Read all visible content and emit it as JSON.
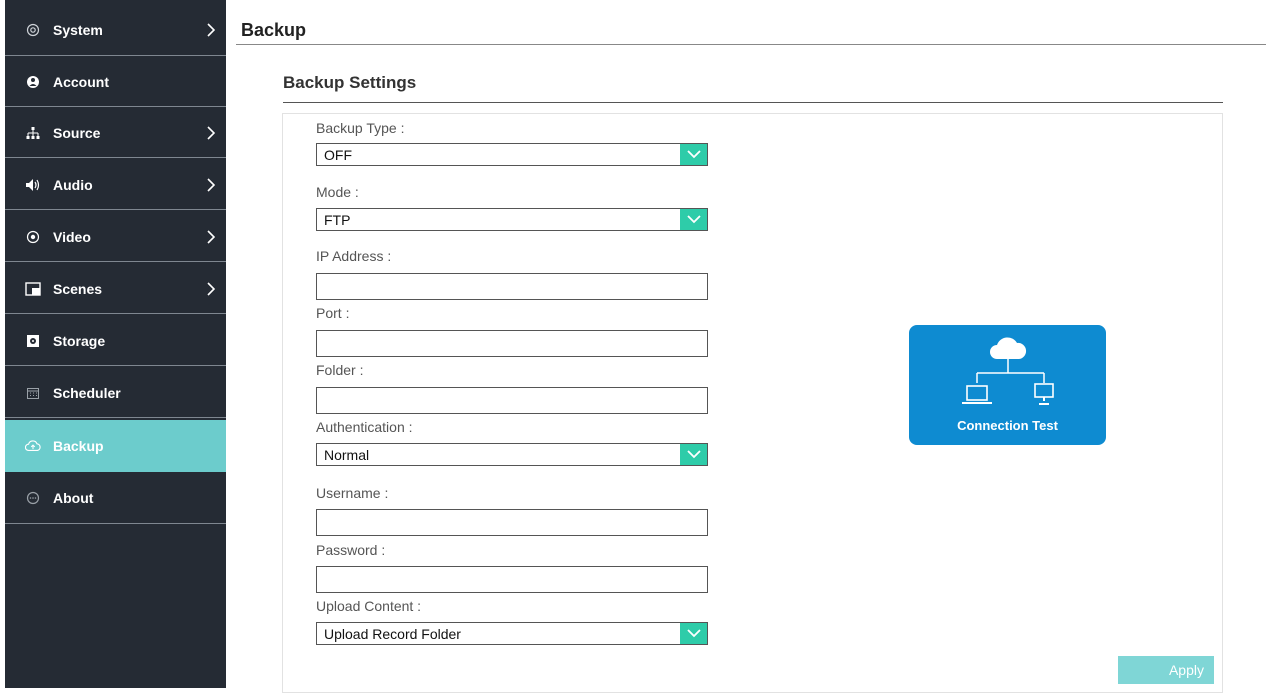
{
  "sidebar": {
    "items": [
      {
        "label": "System",
        "icon": "system-icon",
        "chevron": true,
        "active": false
      },
      {
        "label": "Account",
        "icon": "account-icon",
        "chevron": false,
        "active": false
      },
      {
        "label": "Source",
        "icon": "source-icon",
        "chevron": true,
        "active": false
      },
      {
        "label": "Audio",
        "icon": "audio-icon",
        "chevron": true,
        "active": false
      },
      {
        "label": "Video",
        "icon": "video-icon",
        "chevron": true,
        "active": false
      },
      {
        "label": "Scenes",
        "icon": "scenes-icon",
        "chevron": true,
        "active": false
      },
      {
        "label": "Storage",
        "icon": "storage-icon",
        "chevron": false,
        "active": false
      },
      {
        "label": "Scheduler",
        "icon": "scheduler-icon",
        "chevron": false,
        "active": false
      },
      {
        "label": "Backup",
        "icon": "backup-icon",
        "chevron": false,
        "active": true
      },
      {
        "label": "About",
        "icon": "about-icon",
        "chevron": false,
        "active": false
      }
    ]
  },
  "header": {
    "title": "Backup"
  },
  "section": {
    "title": "Backup Settings"
  },
  "form": {
    "backup_type": {
      "label": "Backup Type :",
      "value": "OFF"
    },
    "mode": {
      "label": "Mode :",
      "value": "FTP"
    },
    "ip_address": {
      "label": "IP Address :",
      "value": ""
    },
    "port": {
      "label": "Port :",
      "value": ""
    },
    "folder": {
      "label": "Folder :",
      "value": ""
    },
    "authentication": {
      "label": "Authentication :",
      "value": "Normal"
    },
    "username": {
      "label": "Username :",
      "value": ""
    },
    "password": {
      "label": "Password :",
      "value": ""
    },
    "upload_content": {
      "label": "Upload Content :",
      "value": "Upload Record Folder"
    }
  },
  "connection_test": {
    "label": "Connection Test"
  },
  "apply": {
    "label": "Apply"
  },
  "colors": {
    "sidebar_bg": "#252b34",
    "active": "#6ccccc",
    "select_button": "#2ecca9",
    "connection_test_bg": "#0e8bd1",
    "apply_bg": "#7fd6d6"
  }
}
